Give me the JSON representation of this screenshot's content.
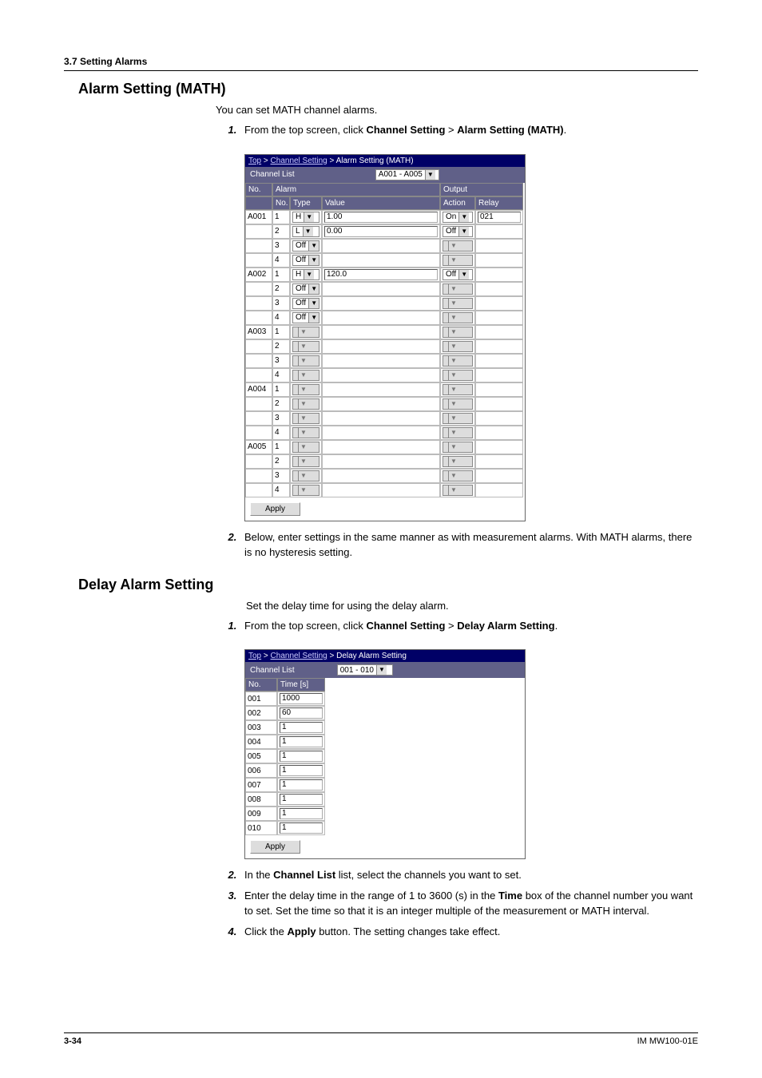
{
  "header": {
    "section": "3.7  Setting Alarms"
  },
  "math": {
    "heading": "Alarm Setting (MATH)",
    "intro": "You can set MATH channel alarms.",
    "step1_a": "From the top screen, click ",
    "step1_b": "Channel Setting",
    "step1_c": " > ",
    "step1_d": "Alarm Setting (MATH)",
    "step1_e": ".",
    "step2": "Below, enter settings in the same manner as with measurement alarms. With MATH alarms, there is no hysteresis setting.",
    "shot": {
      "bc": {
        "top": "Top",
        "cs": "Channel Setting",
        "as": "Alarm Setting (MATH)"
      },
      "channel_list_label": "Channel List",
      "channel_list_value": "A001 - A005",
      "cols": {
        "no": "No.",
        "alarm": "Alarm",
        "ano": "No.",
        "type": "Type",
        "value": "Value",
        "output": "Output",
        "action": "Action",
        "relay": "Relay"
      },
      "rows": [
        {
          "ch": "A001",
          "sub": [
            {
              "n": "1",
              "type": "H",
              "val": "1.00",
              "act": "On",
              "relay": "021"
            },
            {
              "n": "2",
              "type": "L",
              "val": "0.00",
              "act": "Off",
              "relay": ""
            },
            {
              "n": "3",
              "type": "Off",
              "val": "",
              "act": "",
              "relay": ""
            },
            {
              "n": "4",
              "type": "Off",
              "val": "",
              "act": "",
              "relay": ""
            }
          ]
        },
        {
          "ch": "A002",
          "sub": [
            {
              "n": "1",
              "type": "H",
              "val": "120.0",
              "act": "Off",
              "relay": ""
            },
            {
              "n": "2",
              "type": "Off",
              "val": "",
              "act": "",
              "relay": ""
            },
            {
              "n": "3",
              "type": "Off",
              "val": "",
              "act": "",
              "relay": ""
            },
            {
              "n": "4",
              "type": "Off",
              "val": "",
              "act": "",
              "relay": ""
            }
          ]
        },
        {
          "ch": "A003",
          "sub": [
            {
              "n": "1",
              "type": "",
              "val": "",
              "act": "",
              "relay": ""
            },
            {
              "n": "2",
              "type": "",
              "val": "",
              "act": "",
              "relay": ""
            },
            {
              "n": "3",
              "type": "",
              "val": "",
              "act": "",
              "relay": ""
            },
            {
              "n": "4",
              "type": "",
              "val": "",
              "act": "",
              "relay": ""
            }
          ]
        },
        {
          "ch": "A004",
          "sub": [
            {
              "n": "1",
              "type": "",
              "val": "",
              "act": "",
              "relay": ""
            },
            {
              "n": "2",
              "type": "",
              "val": "",
              "act": "",
              "relay": ""
            },
            {
              "n": "3",
              "type": "",
              "val": "",
              "act": "",
              "relay": ""
            },
            {
              "n": "4",
              "type": "",
              "val": "",
              "act": "",
              "relay": ""
            }
          ]
        },
        {
          "ch": "A005",
          "sub": [
            {
              "n": "1",
              "type": "",
              "val": "",
              "act": "",
              "relay": ""
            },
            {
              "n": "2",
              "type": "",
              "val": "",
              "act": "",
              "relay": ""
            },
            {
              "n": "3",
              "type": "",
              "val": "",
              "act": "",
              "relay": ""
            },
            {
              "n": "4",
              "type": "",
              "val": "",
              "act": "",
              "relay": ""
            }
          ]
        }
      ],
      "apply": "Apply"
    }
  },
  "delay": {
    "heading": "Delay Alarm Setting",
    "intro": "Set the delay time for using the delay alarm.",
    "step1_a": "From the top screen, click ",
    "step1_b": "Channel Setting",
    "step1_c": " > ",
    "step1_d": "Delay Alarm Setting",
    "step1_e": ".",
    "step2_a": "In the ",
    "step2_b": "Channel List",
    "step2_c": " list, select the channels you want to set.",
    "step3_a": "Enter the delay time in the range of 1 to 3600 (s) in the ",
    "step3_b": "Time",
    "step3_c": " box of the channel number you want to set. Set the time so that it is an integer multiple of the measurement or MATH interval.",
    "step4_a": "Click the ",
    "step4_b": "Apply",
    "step4_c": " button. The setting changes take effect.",
    "shot": {
      "bc": {
        "top": "Top",
        "cs": "Channel Setting",
        "das": "Delay Alarm Setting"
      },
      "channel_list_label": "Channel List",
      "channel_list_value": "001 - 010",
      "cols": {
        "no": "No.",
        "time": "Time [s]"
      },
      "rows": [
        {
          "no": "001",
          "time": "1000"
        },
        {
          "no": "002",
          "time": "60"
        },
        {
          "no": "003",
          "time": "1"
        },
        {
          "no": "004",
          "time": "1"
        },
        {
          "no": "005",
          "time": "1"
        },
        {
          "no": "006",
          "time": "1"
        },
        {
          "no": "007",
          "time": "1"
        },
        {
          "no": "008",
          "time": "1"
        },
        {
          "no": "009",
          "time": "1"
        },
        {
          "no": "010",
          "time": "1"
        }
      ],
      "apply": "Apply"
    }
  },
  "footer": {
    "page": "3-34",
    "doc": "IM MW100-01E"
  }
}
